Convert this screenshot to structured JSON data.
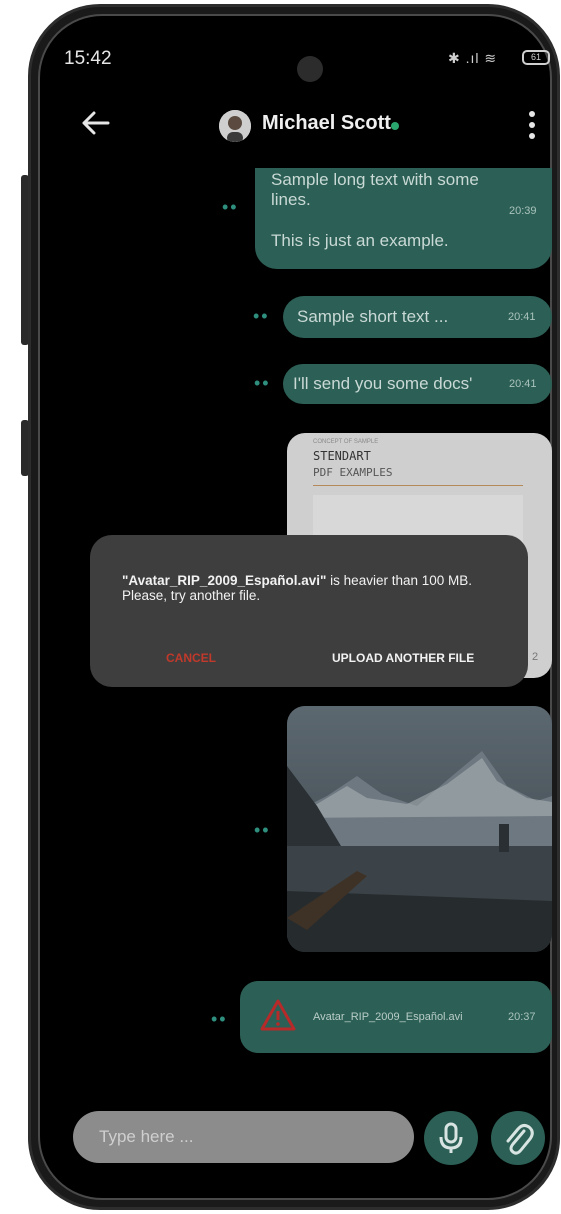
{
  "status_bar": {
    "time": "15:42",
    "icons": "✱ .ıl ≋",
    "battery": "61"
  },
  "header": {
    "contact_name": "Michael Scott",
    "online_color": "#2aa56e"
  },
  "messages": [
    {
      "text_line1": "Sample long text with some",
      "text_line2": "lines.",
      "text_line3": "This is just an example.",
      "time": "20:39"
    },
    {
      "text": "Sample short text ...",
      "time": "20:41"
    },
    {
      "text": "I'll send you some docs'",
      "time": "20:41"
    },
    {
      "doc_brand_small": "CONCEPT OF SAMPLE",
      "doc_title": "STENDART",
      "doc_subtitle": "PDF EXAMPLES",
      "time_partial": "2"
    },
    {
      "image_desc": "mountain lake landscape"
    },
    {
      "file_name": "Avatar_RIP_2009_Español.avi",
      "time": "20:37"
    }
  ],
  "dialog": {
    "message_bold": "\"Avatar_RIP_2009_Español.avi\"",
    "message_rest": " is heavier than 100 MB. Please, try another file.",
    "cancel_label": "CANCEL",
    "upload_label": "UPLOAD ANOTHER FILE"
  },
  "composer": {
    "placeholder": "Type here ..."
  },
  "colors": {
    "accent": "#2c5f55",
    "cancel": "#c0392b",
    "warning": "#b62a2a"
  }
}
